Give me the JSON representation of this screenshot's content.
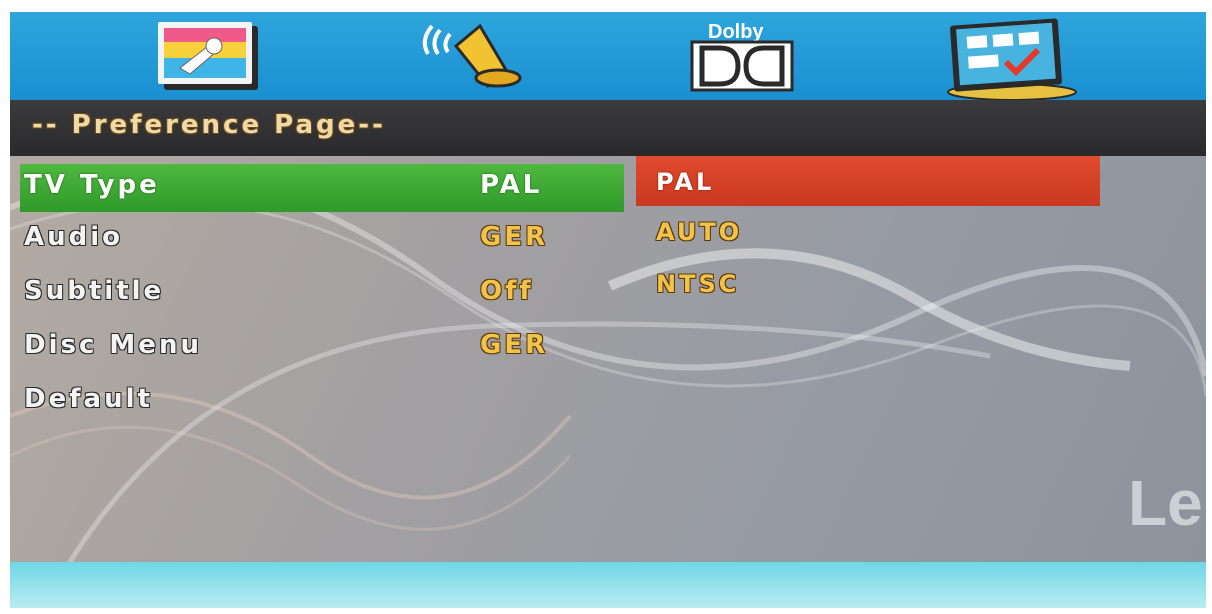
{
  "window": {
    "tabs": [
      {
        "name": "general-setup",
        "icon": "settings-wrench-icon"
      },
      {
        "name": "audio-setup",
        "icon": "speaker-icon"
      },
      {
        "name": "dolby-setup",
        "icon": "dolby-icon",
        "label": "Dolby"
      },
      {
        "name": "preference-setup",
        "icon": "preference-checklist-icon"
      }
    ],
    "active_tab": "preference-setup"
  },
  "header": {
    "title": "-- Preference Page--"
  },
  "menu": {
    "items": [
      {
        "label": "TV Type",
        "value": "PAL",
        "selected": true
      },
      {
        "label": "Audio",
        "value": "GER"
      },
      {
        "label": "Subtitle",
        "value": "Off"
      },
      {
        "label": "Disc Menu",
        "value": "GER"
      },
      {
        "label": "Default",
        "value": ""
      }
    ]
  },
  "options": {
    "items": [
      "PAL",
      "AUTO",
      "NTSC"
    ],
    "highlighted": "PAL"
  },
  "watermark": "Le",
  "colors": {
    "icon_bar": "#1a8fd0",
    "header_bg": "#2f2f31",
    "selected_row": "#3aa632",
    "option_highlight": "#d6412a",
    "value_text": "#f2c24a",
    "bottom_bar": "#8fe0ea"
  }
}
